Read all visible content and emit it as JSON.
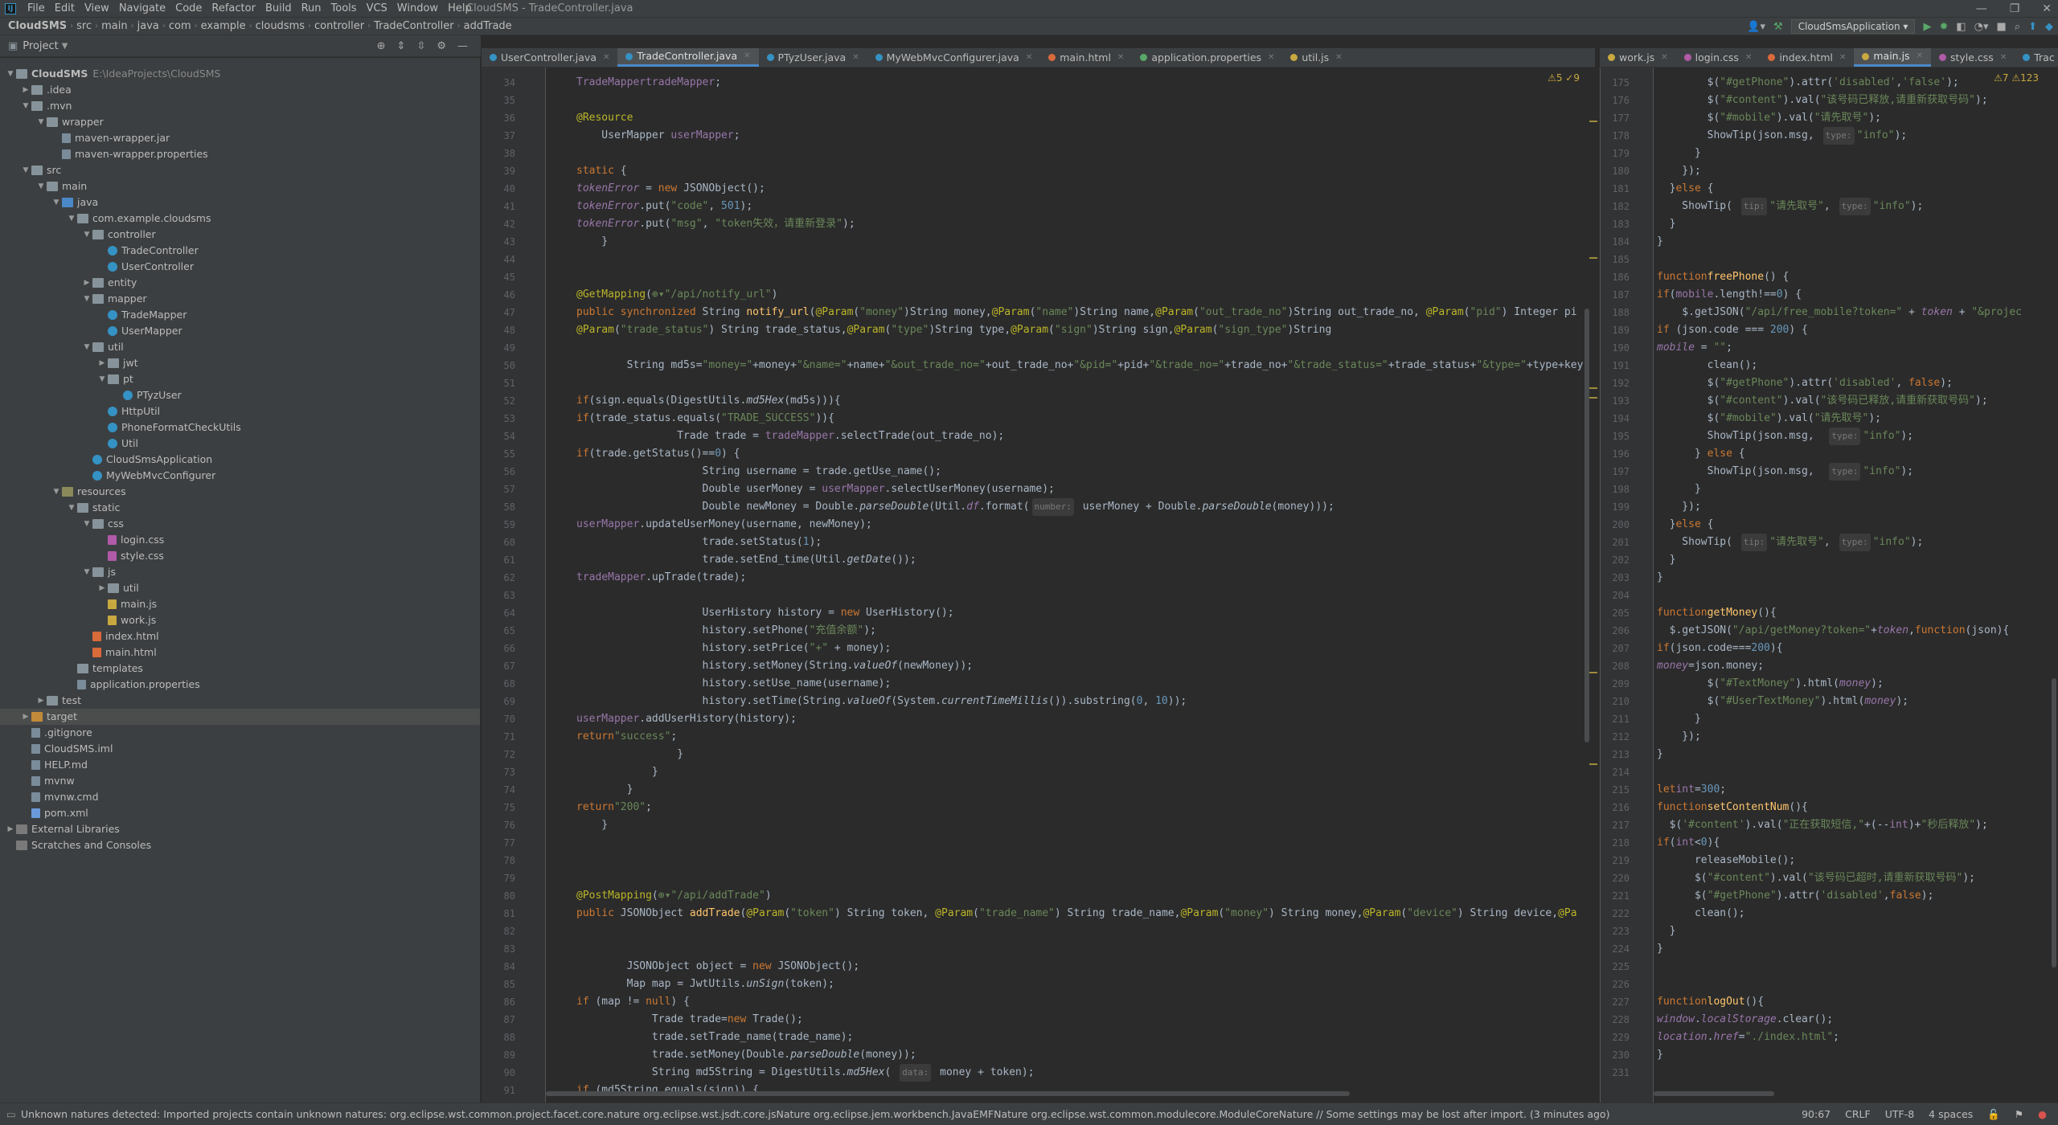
{
  "window": {
    "title": "CloudSMS - TradeController.java"
  },
  "menu": [
    "File",
    "Edit",
    "View",
    "Navigate",
    "Code",
    "Refactor",
    "Build",
    "Run",
    "Tools",
    "VCS",
    "Window",
    "Help"
  ],
  "breadcrumb": [
    "CloudSMS",
    "src",
    "main",
    "java",
    "com",
    "example",
    "cloudsms",
    "controller",
    "TradeController",
    "addTrade"
  ],
  "run_config": "CloudSmsApplication",
  "project_panel": {
    "title": "Project"
  },
  "tree": [
    {
      "d": 0,
      "tw": "▼",
      "icon": "folder",
      "label": "CloudSMS",
      "path": "E:\\IdeaProjects\\CloudSMS",
      "bold": true
    },
    {
      "d": 1,
      "tw": "▶",
      "icon": "folder",
      "label": ".idea"
    },
    {
      "d": 1,
      "tw": "▼",
      "icon": "folder",
      "label": ".mvn"
    },
    {
      "d": 2,
      "tw": "▼",
      "icon": "folder",
      "label": "wrapper"
    },
    {
      "d": 3,
      "tw": "",
      "icon": "file",
      "label": "maven-wrapper.jar"
    },
    {
      "d": 3,
      "tw": "",
      "icon": "file",
      "label": "maven-wrapper.properties"
    },
    {
      "d": 1,
      "tw": "▼",
      "icon": "folder",
      "label": "src"
    },
    {
      "d": 2,
      "tw": "▼",
      "icon": "folder",
      "label": "main"
    },
    {
      "d": 3,
      "tw": "▼",
      "icon": "folder src",
      "label": "java"
    },
    {
      "d": 4,
      "tw": "▼",
      "icon": "folder",
      "label": "com.example.cloudsms"
    },
    {
      "d": 5,
      "tw": "▼",
      "icon": "folder",
      "label": "controller"
    },
    {
      "d": 6,
      "tw": "",
      "icon": "cls",
      "label": "TradeController"
    },
    {
      "d": 6,
      "tw": "",
      "icon": "cls",
      "label": "UserController"
    },
    {
      "d": 5,
      "tw": "▶",
      "icon": "folder",
      "label": "entity"
    },
    {
      "d": 5,
      "tw": "▼",
      "icon": "folder",
      "label": "mapper"
    },
    {
      "d": 6,
      "tw": "",
      "icon": "cls",
      "label": "TradeMapper"
    },
    {
      "d": 6,
      "tw": "",
      "icon": "cls",
      "label": "UserMapper"
    },
    {
      "d": 5,
      "tw": "▼",
      "icon": "folder",
      "label": "util"
    },
    {
      "d": 6,
      "tw": "▶",
      "icon": "folder",
      "label": "jwt"
    },
    {
      "d": 6,
      "tw": "▼",
      "icon": "folder",
      "label": "pt"
    },
    {
      "d": 7,
      "tw": "",
      "icon": "cls",
      "label": "PTyzUser"
    },
    {
      "d": 6,
      "tw": "",
      "icon": "cls",
      "label": "HttpUtil"
    },
    {
      "d": 6,
      "tw": "",
      "icon": "cls",
      "label": "PhoneFormatCheckUtils"
    },
    {
      "d": 6,
      "tw": "",
      "icon": "cls",
      "label": "Util"
    },
    {
      "d": 5,
      "tw": "",
      "icon": "cls",
      "label": "CloudSmsApplication"
    },
    {
      "d": 5,
      "tw": "",
      "icon": "cls",
      "label": "MyWebMvcConfigurer"
    },
    {
      "d": 3,
      "tw": "▼",
      "icon": "folder res",
      "label": "resources"
    },
    {
      "d": 4,
      "tw": "▼",
      "icon": "folder",
      "label": "static"
    },
    {
      "d": 5,
      "tw": "▼",
      "icon": "folder",
      "label": "css"
    },
    {
      "d": 6,
      "tw": "",
      "icon": "css",
      "label": "login.css"
    },
    {
      "d": 6,
      "tw": "",
      "icon": "css",
      "label": "style.css"
    },
    {
      "d": 5,
      "tw": "▼",
      "icon": "folder",
      "label": "js"
    },
    {
      "d": 6,
      "tw": "▶",
      "icon": "folder",
      "label": "util"
    },
    {
      "d": 6,
      "tw": "",
      "icon": "js",
      "label": "main.js"
    },
    {
      "d": 6,
      "tw": "",
      "icon": "js",
      "label": "work.js"
    },
    {
      "d": 5,
      "tw": "",
      "icon": "html",
      "label": "index.html"
    },
    {
      "d": 5,
      "tw": "",
      "icon": "html",
      "label": "main.html"
    },
    {
      "d": 4,
      "tw": "",
      "icon": "folder",
      "label": "templates"
    },
    {
      "d": 4,
      "tw": "",
      "icon": "file",
      "label": "application.properties"
    },
    {
      "d": 2,
      "tw": "▶",
      "icon": "folder",
      "label": "test"
    },
    {
      "d": 1,
      "tw": "▶",
      "icon": "folder tgt",
      "label": "target",
      "sel": true
    },
    {
      "d": 1,
      "tw": "",
      "icon": "file",
      "label": ".gitignore"
    },
    {
      "d": 1,
      "tw": "",
      "icon": "file",
      "label": "CloudSMS.iml"
    },
    {
      "d": 1,
      "tw": "",
      "icon": "file",
      "label": "HELP.md"
    },
    {
      "d": 1,
      "tw": "",
      "icon": "file",
      "label": "mvnw"
    },
    {
      "d": 1,
      "tw": "",
      "icon": "file",
      "label": "mvnw.cmd"
    },
    {
      "d": 1,
      "tw": "",
      "icon": "xml",
      "label": "pom.xml"
    },
    {
      "d": 0,
      "tw": "▶",
      "icon": "lib",
      "label": "External Libraries"
    },
    {
      "d": 0,
      "tw": "",
      "icon": "lib",
      "label": "Scratches and Consoles"
    }
  ],
  "tabs_left": [
    {
      "label": "UserController.java",
      "color": "#3592c4"
    },
    {
      "label": "TradeController.java",
      "color": "#3592c4",
      "active": true
    },
    {
      "label": "PTyzUser.java",
      "color": "#3592c4"
    },
    {
      "label": "MyWebMvcConfigurer.java",
      "color": "#3592c4"
    },
    {
      "label": "main.html",
      "color": "#d96a3a"
    },
    {
      "label": "application.properties",
      "color": "#59a869"
    },
    {
      "label": "util.js",
      "color": "#c8a840"
    }
  ],
  "tabs_right": [
    {
      "label": "work.js",
      "color": "#c8a840"
    },
    {
      "label": "login.css",
      "color": "#b05aa8"
    },
    {
      "label": "index.html",
      "color": "#d96a3a"
    },
    {
      "label": "main.js",
      "color": "#c8a840",
      "active": true
    },
    {
      "label": "style.css",
      "color": "#b05aa8"
    },
    {
      "label": "Trac",
      "color": "#3592c4"
    }
  ],
  "left_inspection": "⚠5  ✓9",
  "right_inspection": "⚠7  ⚠123",
  "left_code": [
    {
      "n": "34",
      "h": "    <span class='fld'>TradeMapper</span> <span class='fld'>tradeMapper</span>;"
    },
    {
      "n": "35",
      "h": ""
    },
    {
      "n": "36",
      "h": "    <span class='an'>@Resource</span>"
    },
    {
      "n": "37",
      "h": "    UserMapper <span class='fld'>userMapper</span>;"
    },
    {
      "n": "38",
      "h": ""
    },
    {
      "n": "39",
      "h": "    <span class='kw'>static</span> {"
    },
    {
      "n": "40",
      "h": "        <span class='fld it'>tokenError</span> = <span class='kw'>new</span> JSONObject();"
    },
    {
      "n": "41",
      "h": "        <span class='fld it'>tokenError</span>.put(<span class='st'>\"code\"</span>, <span class='nm'>501</span>);"
    },
    {
      "n": "42",
      "h": "        <span class='fld it'>tokenError</span>.put(<span class='st'>\"msg\"</span>, <span class='st'>\"token失效，请重新登录\"</span>);"
    },
    {
      "n": "43",
      "h": "    }"
    },
    {
      "n": "44",
      "h": ""
    },
    {
      "n": "45",
      "h": ""
    },
    {
      "n": "46",
      "h": "    <span class='an'>@GetMapping</span>(<span class='st'>⊕▾\"/api/notify_url\"</span>)"
    },
    {
      "n": "47",
      "h": "    <span class='kw'>public synchronized</span> String <span class='fn'>notify_url</span>(<span class='an'>@Param</span>(<span class='st'>\"money\"</span>)String money,<span class='an'>@Param</span>(<span class='st'>\"name\"</span>)String name,<span class='an'>@Param</span>(<span class='st'>\"out_trade_no\"</span>)String out_trade_no, <span class='an'>@Param</span>(<span class='st'>\"pid\"</span>) Integer pi"
    },
    {
      "n": "48",
      "h": "                                         <span class='an'>@Param</span>(<span class='st'>\"trade_status\"</span>) String trade_status,<span class='an'>@Param</span>(<span class='st'>\"type\"</span>)String type,<span class='an'>@Param</span>(<span class='st'>\"sign\"</span>)String sign,<span class='an'>@Param</span>(<span class='st'>\"sign_type\"</span>)String"
    },
    {
      "n": "49",
      "h": ""
    },
    {
      "n": "50",
      "h": "        String md5s=<span class='st'>\"money=\"</span>+money+<span class='st'>\"&amp;name=\"</span>+name+<span class='st'>\"&amp;out_trade_no=\"</span>+out_trade_no+<span class='st'>\"&amp;pid=\"</span>+pid+<span class='st'>\"&amp;trade_no=\"</span>+trade_no+<span class='st'>\"&amp;trade_status=\"</span>+trade_status+<span class='st'>\"&amp;type=\"</span>+type+key;"
    },
    {
      "n": "51",
      "h": ""
    },
    {
      "n": "52",
      "h": "        <span class='kw'>if</span>(sign.equals(DigestUtils.<span class='it'>md5Hex</span>(md5s))){"
    },
    {
      "n": "53",
      "h": "            <span class='kw'>if</span>(trade_status.equals(<span class='st'>\"TRADE_SUCCESS\"</span>)){"
    },
    {
      "n": "54",
      "h": "                Trade trade = <span class='fld'>tradeMapper</span>.selectTrade(out_trade_no);"
    },
    {
      "n": "55",
      "h": "                <span class='kw'>if</span>(trade.getStatus()==<span class='nm'>0</span>) {"
    },
    {
      "n": "56",
      "h": "                    String username = trade.getUse_name();"
    },
    {
      "n": "57",
      "h": "                    Double userMoney = <span class='fld'>userMapper</span>.selectUserMoney(username);"
    },
    {
      "n": "58",
      "h": "                    Double newMoney = Double.<span class='it'>parseDouble</span>(Util.<span class='fld it'>df</span>.format(<span class='hint'>number:</span> userMoney + Double.<span class='it'>parseDouble</span>(money)));"
    },
    {
      "n": "59",
      "h": "                    <span class='fld'>userMapper</span>.updateUserMoney(username, newMoney);"
    },
    {
      "n": "60",
      "h": "                    trade.setStatus(<span class='nm'>1</span>);"
    },
    {
      "n": "61",
      "h": "                    trade.setEnd_time(Util.<span class='it'>getDate</span>());"
    },
    {
      "n": "62",
      "h": "                    <span class='fld'>tradeMapper</span>.upTrade(trade);"
    },
    {
      "n": "63",
      "h": ""
    },
    {
      "n": "64",
      "h": "                    UserHistory history = <span class='kw'>new</span> UserHistory();"
    },
    {
      "n": "65",
      "h": "                    history.setPhone(<span class='st'>\"充值余额\"</span>);"
    },
    {
      "n": "66",
      "h": "                    history.setPrice(<span class='st'>\"+\"</span> + money);"
    },
    {
      "n": "67",
      "h": "                    history.setMoney(String.<span class='it'>valueOf</span>(newMoney));"
    },
    {
      "n": "68",
      "h": "                    history.setUse_name(username);"
    },
    {
      "n": "69",
      "h": "                    history.setTime(String.<span class='it'>valueOf</span>(System.<span class='it'>currentTimeMillis</span>()).substring(<span class='nm'>0</span>, <span class='nm'>10</span>));"
    },
    {
      "n": "70",
      "h": "                    <span class='fld'>userMapper</span>.addUserHistory(history);"
    },
    {
      "n": "71",
      "h": "                    <span class='kw'>return</span> <span class='st'>\"success\"</span>;"
    },
    {
      "n": "72",
      "h": "                }"
    },
    {
      "n": "73",
      "h": "            }"
    },
    {
      "n": "74",
      "h": "        }"
    },
    {
      "n": "75",
      "h": "        <span class='kw'>return</span> <span class='st'>\"200\"</span>;"
    },
    {
      "n": "76",
      "h": "    }"
    },
    {
      "n": "77",
      "h": ""
    },
    {
      "n": "78",
      "h": ""
    },
    {
      "n": "79",
      "h": ""
    },
    {
      "n": "80",
      "h": "    <span class='an'>@PostMapping</span>(<span class='st'>⊕▾\"/api/addTrade\"</span>)"
    },
    {
      "n": "81",
      "h": "    <span class='kw'>public</span> JSONObject <span class='fn'>addTrade</span>(<span class='an'>@Param</span>(<span class='st'>\"token\"</span>) String token, <span class='an'>@Param</span>(<span class='st'>\"trade_name\"</span>) String trade_name,<span class='an'>@Param</span>(<span class='st'>\"money\"</span>) String money,<span class='an'>@Param</span>(<span class='st'>\"device\"</span>) String device,<span class='an'>@Pa</span>"
    },
    {
      "n": "82",
      "h": ""
    },
    {
      "n": "83",
      "h": ""
    },
    {
      "n": "84",
      "h": "        JSONObject object = <span class='kw'>new</span> JSONObject();"
    },
    {
      "n": "85",
      "h": "        Map map = JwtUtils.<span class='it'>unSign</span>(token);"
    },
    {
      "n": "86",
      "h": "        <span class='kw'>if</span> (map != <span class='kw'>null</span>) {"
    },
    {
      "n": "87",
      "h": "            Trade trade=<span class='kw'>new</span> Trade();"
    },
    {
      "n": "88",
      "h": "            trade.setTrade_name(trade_name);"
    },
    {
      "n": "89",
      "h": "            trade.setMoney(Double.<span class='it'>parseDouble</span>(money));"
    },
    {
      "n": "90",
      "h": "            String md5String = DigestUtils.<span class='it'>md5Hex</span>( <span class='hint'>data:</span> money + token);"
    },
    {
      "n": "91",
      "h": "            <span class='kw'>if</span> (md5String.equals(sign)) {"
    }
  ],
  "right_code": [
    {
      "n": "175",
      "h": "        $(<span class='st'>\"#getPhone\"</span>).attr(<span class='st'>'disabled'</span>,<span class='st'>'false'</span>);"
    },
    {
      "n": "176",
      "h": "        $(<span class='st'>\"#content\"</span>).val(<span class='st'>\"该号码已释放,请重新获取号码\"</span>);"
    },
    {
      "n": "177",
      "h": "        $(<span class='st'>\"#mobile\"</span>).val(<span class='st'>\"请先取号\"</span>);"
    },
    {
      "n": "178",
      "h": "        ShowTip(json.msg, <span class='hint'>type:</span> <span class='st'>\"info\"</span>);"
    },
    {
      "n": "179",
      "h": "      }"
    },
    {
      "n": "180",
      "h": "    });"
    },
    {
      "n": "181",
      "h": "  }<span class='kw'>else</span> {"
    },
    {
      "n": "182",
      "h": "    ShowTip( <span class='hint'>tip:</span> <span class='st'>\"请先取号\"</span>, <span class='hint'>type:</span> <span class='st'>\"info\"</span>);"
    },
    {
      "n": "183",
      "h": "  }"
    },
    {
      "n": "184",
      "h": "}"
    },
    {
      "n": "185",
      "h": ""
    },
    {
      "n": "186",
      "h": "<span class='kw'>function</span> <span class='fn'>freePhone</span>() {"
    },
    {
      "n": "187",
      "h": "  <span class='kw'>if</span>(<span class='fld'>mobile</span>.length!==<span class='nm'>0</span>) {"
    },
    {
      "n": "188",
      "h": "    $.getJSON(<span class='st'>\"/api/free_mobile?token=\"</span> + <span class='fld it'>token</span> + <span class='st'>\"&amp;projec</span>"
    },
    {
      "n": "189",
      "h": "      <span class='kw'>if</span> (json.code === <span class='nm'>200</span>) {"
    },
    {
      "n": "190",
      "h": "        <span class='fld it'>mobile</span> = <span class='st'>\"\"</span>;"
    },
    {
      "n": "191",
      "h": "        clean();"
    },
    {
      "n": "192",
      "h": "        $(<span class='st'>\"#getPhone\"</span>).attr(<span class='st'>'disabled'</span>, <span class='kw'>false</span>);"
    },
    {
      "n": "193",
      "h": "        $(<span class='st'>\"#content\"</span>).val(<span class='st'>\"该号码已释放,请重新获取号码\"</span>);"
    },
    {
      "n": "194",
      "h": "        $(<span class='st'>\"#mobile\"</span>).val(<span class='st'>\"请先取号\"</span>);"
    },
    {
      "n": "195",
      "h": "        ShowTip(json.msg,  <span class='hint'>type:</span> <span class='st'>\"info\"</span>);"
    },
    {
      "n": "196",
      "h": "      } <span class='kw'>else</span> {"
    },
    {
      "n": "197",
      "h": "        ShowTip(json.msg,  <span class='hint'>type:</span> <span class='st'>\"info\"</span>);"
    },
    {
      "n": "198",
      "h": "      }"
    },
    {
      "n": "199",
      "h": "    });"
    },
    {
      "n": "200",
      "h": "  }<span class='kw'>else</span> {"
    },
    {
      "n": "201",
      "h": "    ShowTip( <span class='hint'>tip:</span> <span class='st'>\"请先取号\"</span>, <span class='hint'>type:</span> <span class='st'>\"info\"</span>);"
    },
    {
      "n": "202",
      "h": "  }"
    },
    {
      "n": "203",
      "h": "}"
    },
    {
      "n": "204",
      "h": ""
    },
    {
      "n": "205",
      "h": "<span class='kw'>function</span> <span class='fn'>getMoney</span>(){"
    },
    {
      "n": "206",
      "h": "  $.getJSON(<span class='st'>\"/api/getMoney?token=\"</span>+<span class='fld it'>token</span>,<span class='kw'>function</span>(json){"
    },
    {
      "n": "207",
      "h": "      <span class='kw'>if</span>(json.code===<span class='nm'>200</span>){"
    },
    {
      "n": "208",
      "h": "        <span class='fld it'>money</span>=json.money;"
    },
    {
      "n": "209",
      "h": "        $(<span class='st'>\"#TextMoney\"</span>).html(<span class='fld it'>money</span>);"
    },
    {
      "n": "210",
      "h": "        $(<span class='st'>\"#UserTextMoney\"</span>).html(<span class='fld it'>money</span>);"
    },
    {
      "n": "211",
      "h": "      }"
    },
    {
      "n": "212",
      "h": "    });"
    },
    {
      "n": "213",
      "h": "}"
    },
    {
      "n": "214",
      "h": ""
    },
    {
      "n": "215",
      "h": "<span class='kw'>let</span> <span class='fld'>int</span>=<span class='nm'>300</span>;"
    },
    {
      "n": "216",
      "h": "<span class='kw'>function</span> <span class='fn'>setContentNum</span>(){"
    },
    {
      "n": "217",
      "h": "  $(<span class='st'>'#content'</span>).val(<span class='st'>\"正在获取短信,\"</span>+(--<span class='fld'>int</span>)+<span class='st'>\"秒后释放\"</span>);"
    },
    {
      "n": "218",
      "h": "  <span class='kw'>if</span>(<span class='fld'>int</span>&lt;<span class='nm'>0</span>){"
    },
    {
      "n": "219",
      "h": "      releaseMobile();"
    },
    {
      "n": "220",
      "h": "      $(<span class='st'>\"#content\"</span>).val(<span class='st'>\"该号码已超时,请重新获取号码\"</span>);"
    },
    {
      "n": "221",
      "h": "      $(<span class='st'>\"#getPhone\"</span>).attr(<span class='st'>'disabled'</span>,<span class='kw'>false</span>);"
    },
    {
      "n": "222",
      "h": "      clean();"
    },
    {
      "n": "223",
      "h": "  }"
    },
    {
      "n": "224",
      "h": "}"
    },
    {
      "n": "225",
      "h": ""
    },
    {
      "n": "226",
      "h": ""
    },
    {
      "n": "227",
      "h": "<span class='kw'>function</span> <span class='fn'>logOut</span>(){"
    },
    {
      "n": "228",
      "h": "    <span class='fld it'>window</span>.<span class='fld it'>localStorage</span>.clear();"
    },
    {
      "n": "229",
      "h": "    <span class='fld it'>location</span>.<span class='fld it'>href</span>=<span class='st'>\"./index.html\"</span>;"
    },
    {
      "n": "230",
      "h": "}"
    },
    {
      "n": "231",
      "h": ""
    }
  ],
  "status": {
    "message": "Unknown natures detected: Imported projects contain unknown natures: org.eclipse.wst.common.project.facet.core.nature org.eclipse.wst.jsdt.core.jsNature org.eclipse.jem.workbench.JavaEMFNature org.eclipse.wst.common.modulecore.ModuleCoreNature // Some settings may be lost after import. (3 minutes ago)",
    "position": "90:67",
    "line_sep": "CRLF",
    "encoding": "UTF-8",
    "indent": "4 spaces"
  }
}
